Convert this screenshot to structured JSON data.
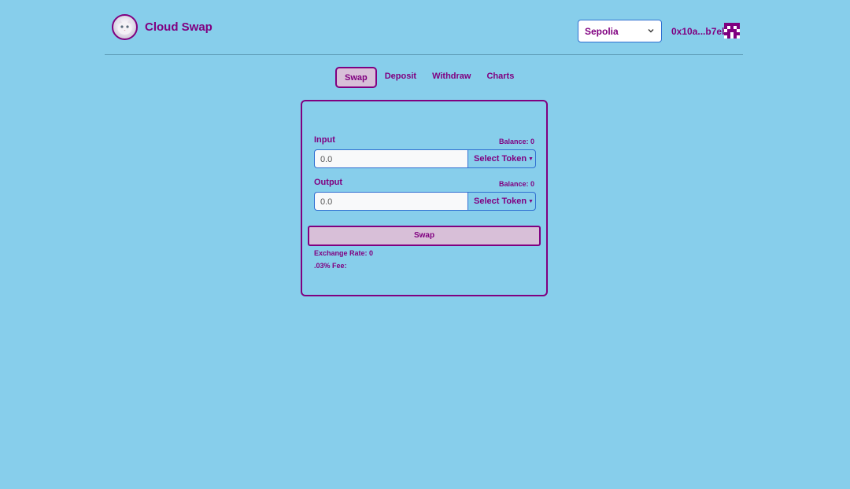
{
  "header": {
    "brand_name": "Cloud Swap",
    "logo_icon": "cat-avatar-icon",
    "network": "Sepolia",
    "account": "0x10a...b7eb",
    "identicon_icon": "identicon-icon"
  },
  "nav": {
    "tabs": [
      {
        "label": "Swap",
        "active": true
      },
      {
        "label": "Deposit",
        "active": false
      },
      {
        "label": "Withdraw",
        "active": false
      },
      {
        "label": "Charts",
        "active": false
      }
    ]
  },
  "swap": {
    "input_label": "Input",
    "input_balance": "Balance: 0",
    "input_placeholder": "0.0",
    "input_token": "Select Token",
    "output_label": "Output",
    "output_balance": "Balance: 0",
    "output_placeholder": "0.0",
    "output_token": "Select Token",
    "swap_button": "Swap",
    "exchange_rate": "Exchange Rate: 0",
    "fee": ".03% Fee:"
  },
  "colors": {
    "background": "#87ceeb",
    "accent": "#800080",
    "button_bg": "#d8bfd8"
  }
}
